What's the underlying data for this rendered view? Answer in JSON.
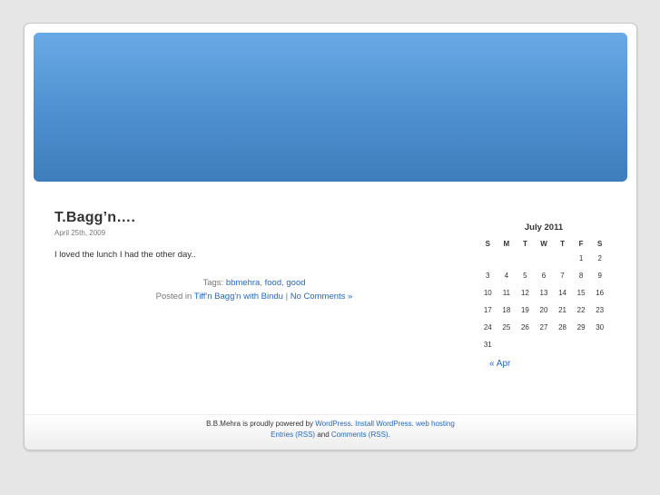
{
  "post": {
    "title": "T.Bagg’n….",
    "date": "April 25th, 2009",
    "body": "I loved the lunch I had the other day..",
    "tags_label": "Tags:",
    "tags": [
      "bbmehra",
      "food",
      "good"
    ],
    "posted_in_label": "Posted in",
    "category": "Tiff'n Bagg'n with Bindu",
    "separator": "|",
    "comments_link": "No Comments »"
  },
  "calendar": {
    "caption": "July 2011",
    "weekdays": [
      "S",
      "M",
      "T",
      "W",
      "T",
      "F",
      "S"
    ],
    "weeks": [
      [
        "",
        "",
        "",
        "",
        "",
        "1",
        "2"
      ],
      [
        "3",
        "4",
        "5",
        "6",
        "7",
        "8",
        "9"
      ],
      [
        "10",
        "11",
        "12",
        "13",
        "14",
        "15",
        "16"
      ],
      [
        "17",
        "18",
        "19",
        "20",
        "21",
        "22",
        "23"
      ],
      [
        "24",
        "25",
        "26",
        "27",
        "28",
        "29",
        "30"
      ],
      [
        "31",
        "",
        "",
        "",
        "",
        "",
        ""
      ]
    ],
    "prev_link": "« Apr"
  },
  "footer": {
    "line1_prefix": "B.B.Mehra is proudly powered by",
    "wordpress_link": "WordPress",
    "install_link": "Install WordPress",
    "hosting_link": "web hosting",
    "entries_link": "Entries (RSS)",
    "and_text": "and",
    "comments_rss_link": "Comments (RSS)"
  },
  "colors": {
    "link": "#2468c0",
    "header_top": "#69aae6",
    "header_bottom": "#3d7dbb",
    "background": "#e6e6e6"
  }
}
